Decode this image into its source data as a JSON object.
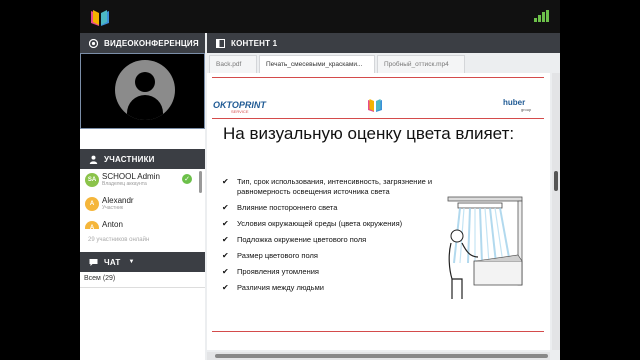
{
  "sidebar": {
    "video_title": "ВИДЕОКОНФЕРЕНЦИЯ",
    "participants_title": "УЧАСТНИКИ",
    "participants": [
      {
        "initials": "SA",
        "name": "SCHOOL Admin",
        "role": "Владелец аккаунта",
        "color": "#8bc34a",
        "verified": true
      },
      {
        "initials": "A",
        "name": "Alexandr",
        "role": "Участник",
        "color": "#f5b63b",
        "verified": false
      },
      {
        "initials": "A",
        "name": "Anton",
        "role": "",
        "color": "#f5b63b",
        "verified": false
      }
    ],
    "participants_count": "29 участников онлайн",
    "chat_title": "ЧАТ",
    "chat_tab": "Всем (29)"
  },
  "content": {
    "title": "КОНТЕНТ 1",
    "tabs": [
      {
        "label": "Back.pdf",
        "active": false
      },
      {
        "label": "Печать_смесевыми_красками...",
        "active": true
      },
      {
        "label": "Пробный_оттиск.mp4",
        "active": false
      }
    ]
  },
  "slide": {
    "brand_left": "OKTOPRINT",
    "brand_left_sub": "SERVICE",
    "brand_right": "huber",
    "brand_right_sub": "group",
    "title": "На визуальную оценку цвета влияет:",
    "bullets": [
      "Тип, срок использования, интенсивность, загрязнение и равномерность освещения источника света",
      "Влияние постороннего света",
      "Условия окружающей среды (цвета окружения)",
      "Подложка окружение цветового поля",
      "Размер цветового поля",
      "Проявления утомления",
      "Различия между людьми"
    ]
  },
  "colors": {
    "accent_green": "#6cc04a",
    "header_dark": "#3b3e44",
    "slide_red_line": "#d44b4b"
  }
}
